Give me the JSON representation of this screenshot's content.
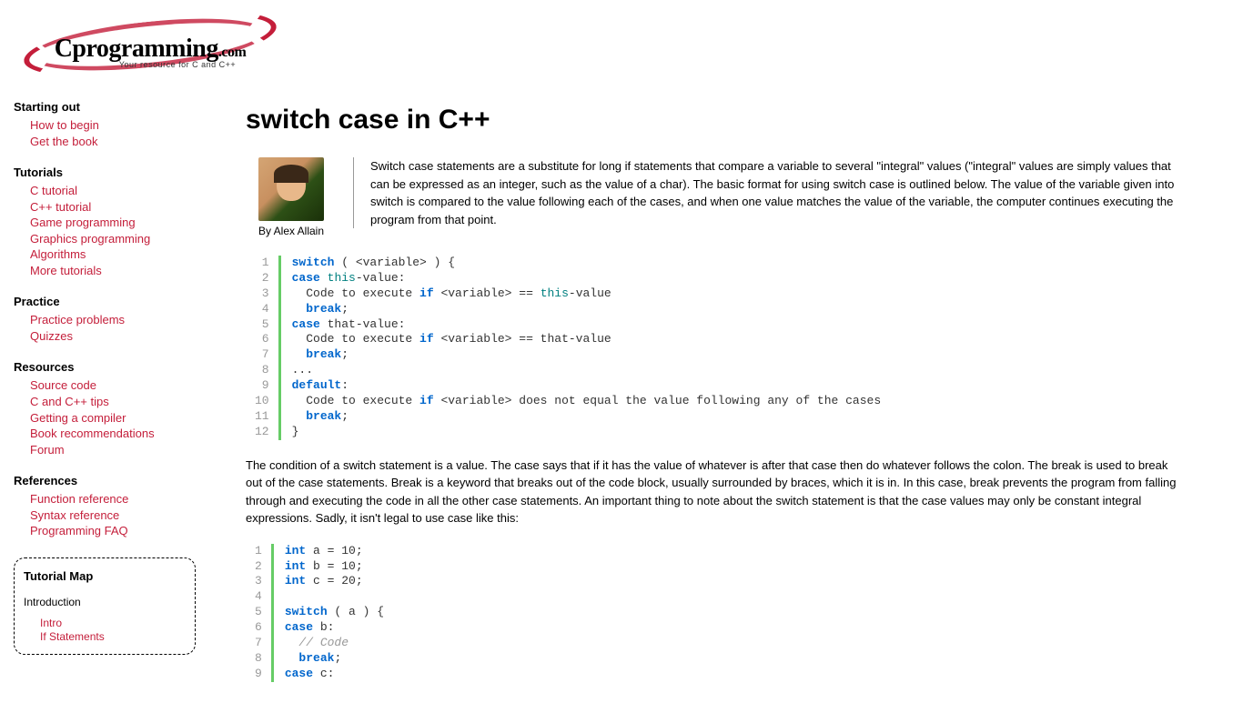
{
  "logo": {
    "main": "Cprogramming",
    "suffix": ".com",
    "tagline": "Your resource for C and C++"
  },
  "nav": {
    "sections": [
      {
        "heading": "Starting out",
        "items": [
          "How to begin",
          "Get the book"
        ]
      },
      {
        "heading": "Tutorials",
        "items": [
          "C tutorial",
          "C++ tutorial",
          "Game programming",
          "Graphics programming",
          "Algorithms",
          "More tutorials"
        ]
      },
      {
        "heading": "Practice",
        "items": [
          "Practice problems",
          "Quizzes"
        ]
      },
      {
        "heading": "Resources",
        "items": [
          "Source code",
          "C and C++ tips",
          "Getting a compiler",
          "Book recommendations",
          "Forum"
        ]
      },
      {
        "heading": "References",
        "items": [
          "Function reference",
          "Syntax reference",
          "Programming FAQ"
        ]
      }
    ]
  },
  "tutorial_map": {
    "title": "Tutorial Map",
    "section_label": "Introduction",
    "items": [
      "Intro",
      "If Statements"
    ]
  },
  "article": {
    "title": "switch case in C++",
    "author": "By Alex Allain",
    "intro": "Switch case statements are a substitute for long if statements that compare a variable to several \"integral\" values (\"integral\" values are simply values that can be expressed as an integer, such as the value of a char). The basic format for using switch case is outlined below. The value of the variable given into switch is compared to the value following each of the cases, and when one value matches the value of the variable, the computer continues executing the program from that point.",
    "para2": "The condition of a switch statement is a value. The case says that if it has the value of whatever is after that case then do whatever follows the colon. The break is used to break out of the case statements. Break is a keyword that breaks out of the code block, usually surrounded by braces, which it is in. In this case, break prevents the program from falling through and executing the code in all the other case statements. An important thing to note about the switch statement is that the case values may only be constant integral expressions. Sadly, it isn't legal to use case like this:",
    "code1_lines": 12,
    "code2_lines": 9
  }
}
